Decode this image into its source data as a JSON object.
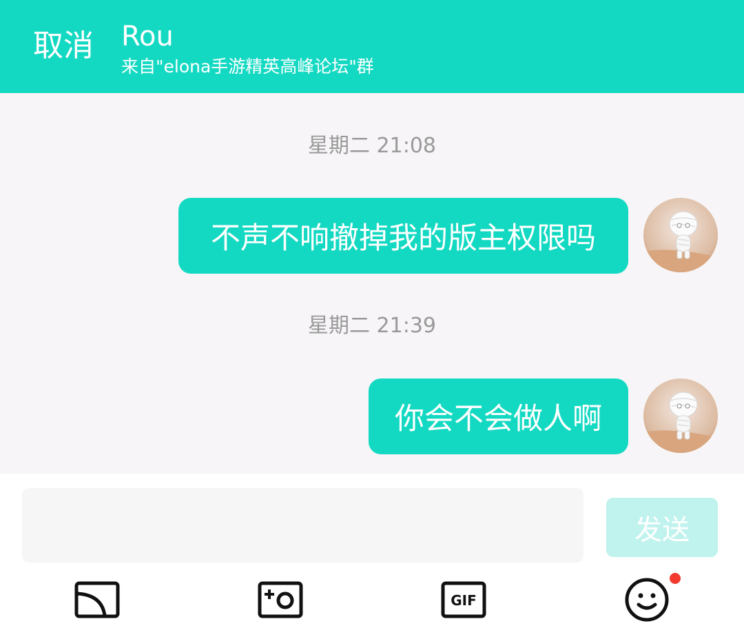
{
  "header": {
    "cancel_label": "取消",
    "title": "Rou",
    "subtitle": "来自\"elona手游精英高峰论坛\"群",
    "background_color": "#14d9c2"
  },
  "messages": [
    {
      "timestamp": "星期二 21:08",
      "text": "不声不响撤掉我的版主权限吗"
    },
    {
      "timestamp": "星期二 21:39",
      "text": "你会不会做人啊"
    }
  ],
  "composer": {
    "input_value": "",
    "send_label": "发送"
  },
  "toolbar": {
    "icons": [
      "cast-icon",
      "camera-icon",
      "gif-icon",
      "emoji-icon"
    ],
    "notification_color": "#f23a2e"
  },
  "colors": {
    "accent": "#14d9c2",
    "timestamp_gray": "#999999",
    "send_disabled": "#c0f3ee"
  }
}
